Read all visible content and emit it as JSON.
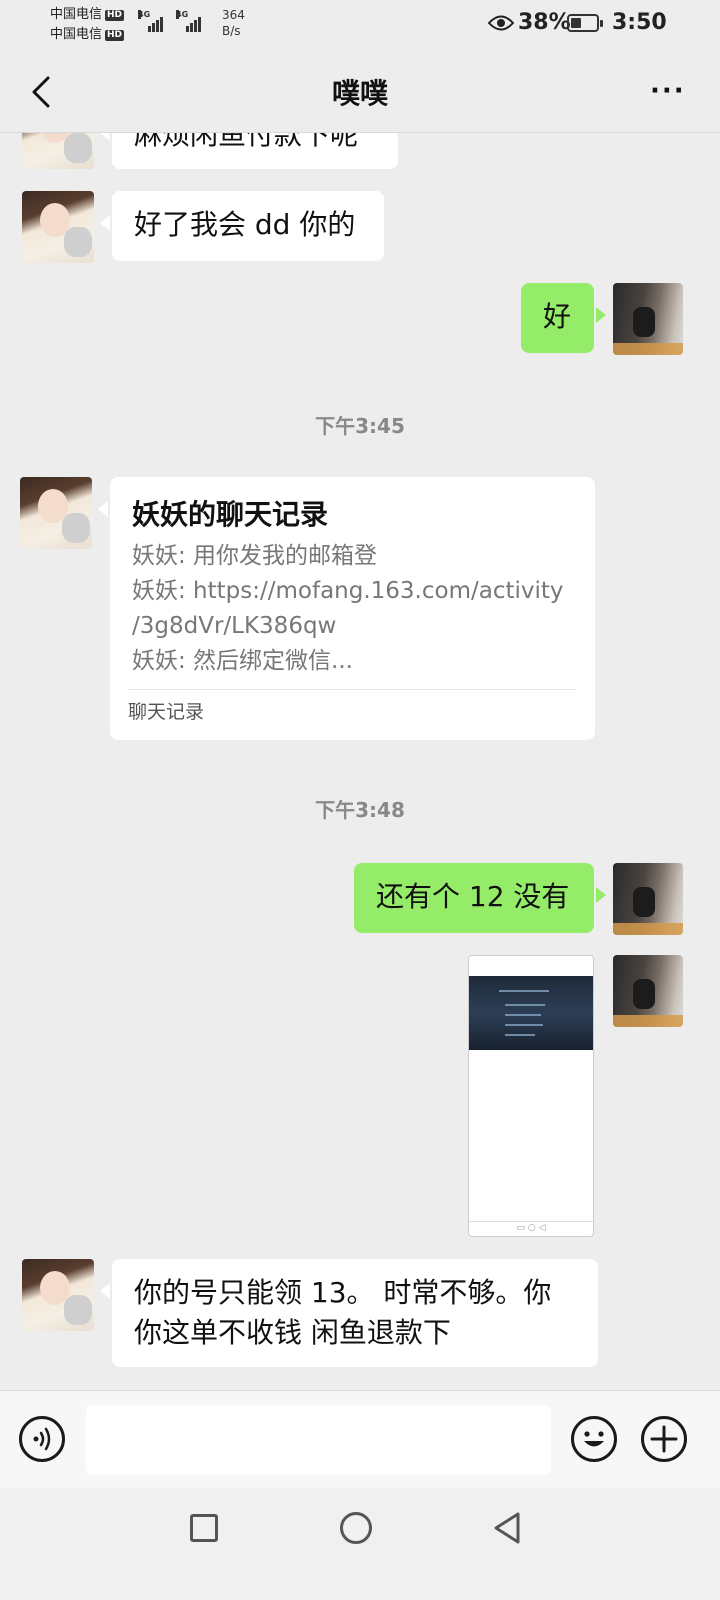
{
  "status_bar": {
    "carrier1": "中国电信",
    "carrier2": "中国电信",
    "hd_badge": "HD",
    "network_type": "4G",
    "net_speed_value": "364",
    "net_speed_unit": "B/s",
    "battery_percent": "38%",
    "time": "3:50"
  },
  "header": {
    "title": "噗噗",
    "more": "···"
  },
  "messages": {
    "m0": "麻烦闲鱼付款下呢",
    "m1": "好了我会 dd 你的",
    "m2": "好",
    "ts1": "下午3:45",
    "card": {
      "title": "妖妖的聊天记录",
      "line1": "妖妖: 用你发我的邮箱登",
      "line2": "妖妖: https://mofang.163.com/activity",
      "line3": "/3g8dVr/LK386qw",
      "line4": "妖妖: 然后绑定微信...",
      "footer": "聊天记录"
    },
    "ts2": "下午3:48",
    "m3": "还有个 12 没有",
    "m5": "你的号只能领 13。 时常不够。你\n你这单不收钱 闲鱼退款下"
  },
  "colors": {
    "background": "#ededed",
    "bubble_green": "#95ec69",
    "bubble_white": "#ffffff"
  },
  "icons": {
    "back": "chevron-left-icon",
    "more": "more-dots-icon",
    "voice": "voice-icon",
    "emoji": "emoji-icon",
    "plus": "plus-icon",
    "nav_recents": "square-icon",
    "nav_home": "circle-icon",
    "nav_back": "triangle-back-icon"
  }
}
